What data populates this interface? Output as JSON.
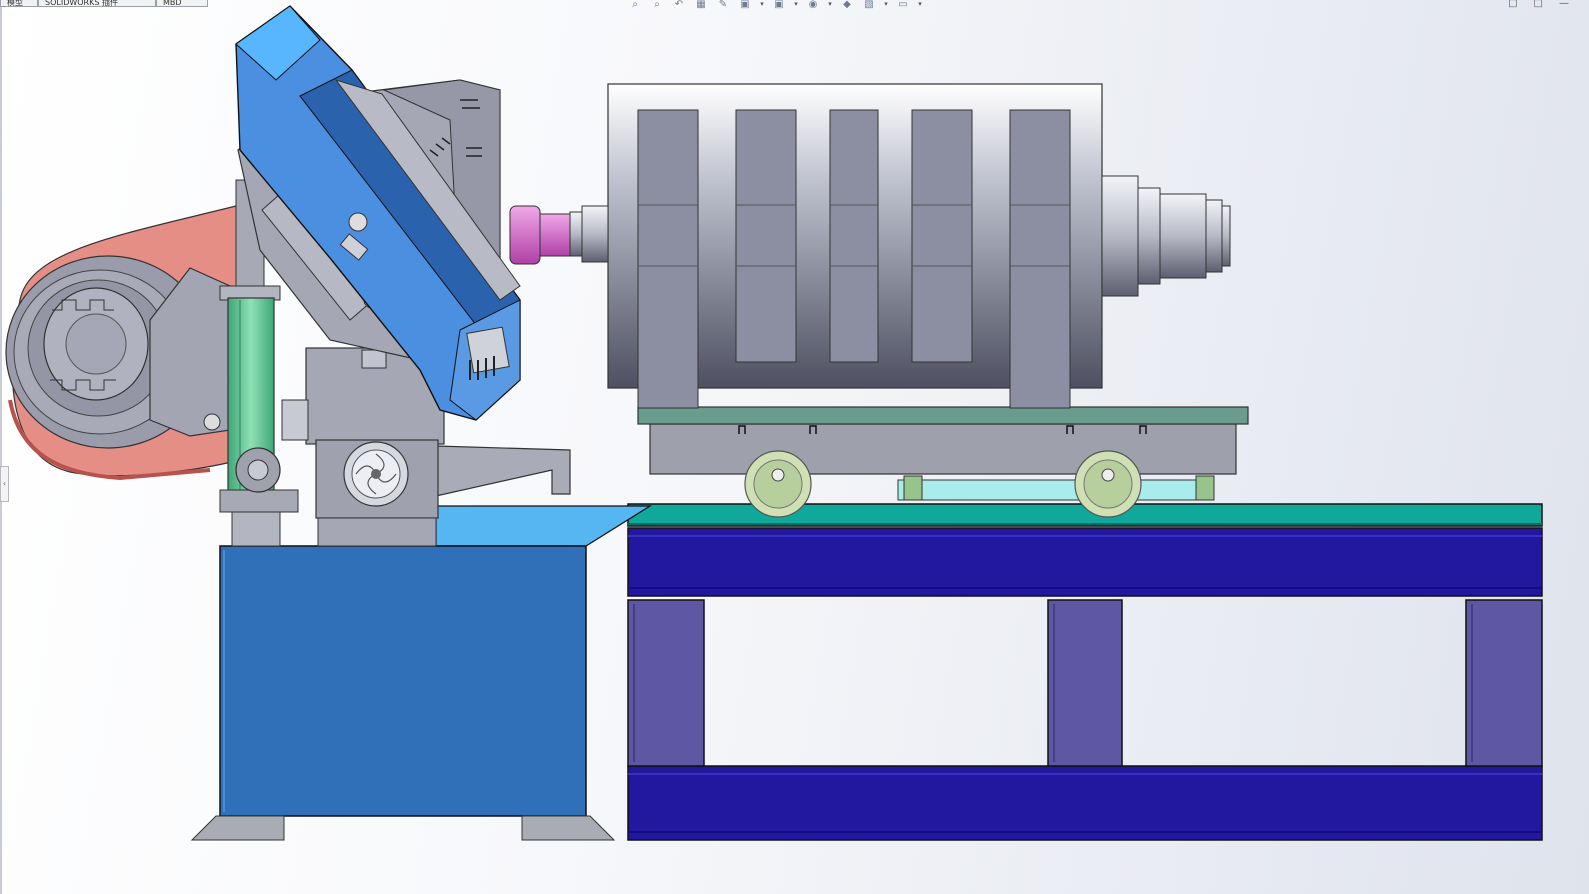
{
  "tabs": [
    {
      "label": "模型"
    },
    {
      "label": "SOLIDWORKS 插件"
    },
    {
      "label": "MBD"
    }
  ],
  "heads_up_toolbar": {
    "icons": [
      "zoom-to-fit-icon",
      "zoom-to-area-icon",
      "previous-view-icon",
      "section-view-icon",
      "dynamic-annotation-icon",
      "view-orientation-icon",
      "display-style-icon",
      "hide-show-items-icon",
      "edit-appearance-icon",
      "apply-scene-icon",
      "view-settings-icon"
    ],
    "glyphs": [
      "⌕",
      "⌕",
      "↶",
      "▦",
      "✎",
      "▣",
      "▣",
      "◉",
      "◆",
      "▧",
      "▭"
    ]
  },
  "window_controls": {
    "glyphs": [
      "□",
      "□",
      "—"
    ]
  },
  "side_handle": {
    "glyph": "‹"
  },
  "colors": {
    "saw_arm_blue": "#4a8fe0",
    "cabinet_blue": "#3070b8",
    "frame_navy": "#2218a0",
    "frame_post_purple": "#5e58a4",
    "table_teal": "#10a89a",
    "belt_guard_salmon": "#e58e86",
    "cylinder_green": "#6ccf9c",
    "coupling_magenta": "#d870c8",
    "motor_gray": "#8a8ea0"
  }
}
